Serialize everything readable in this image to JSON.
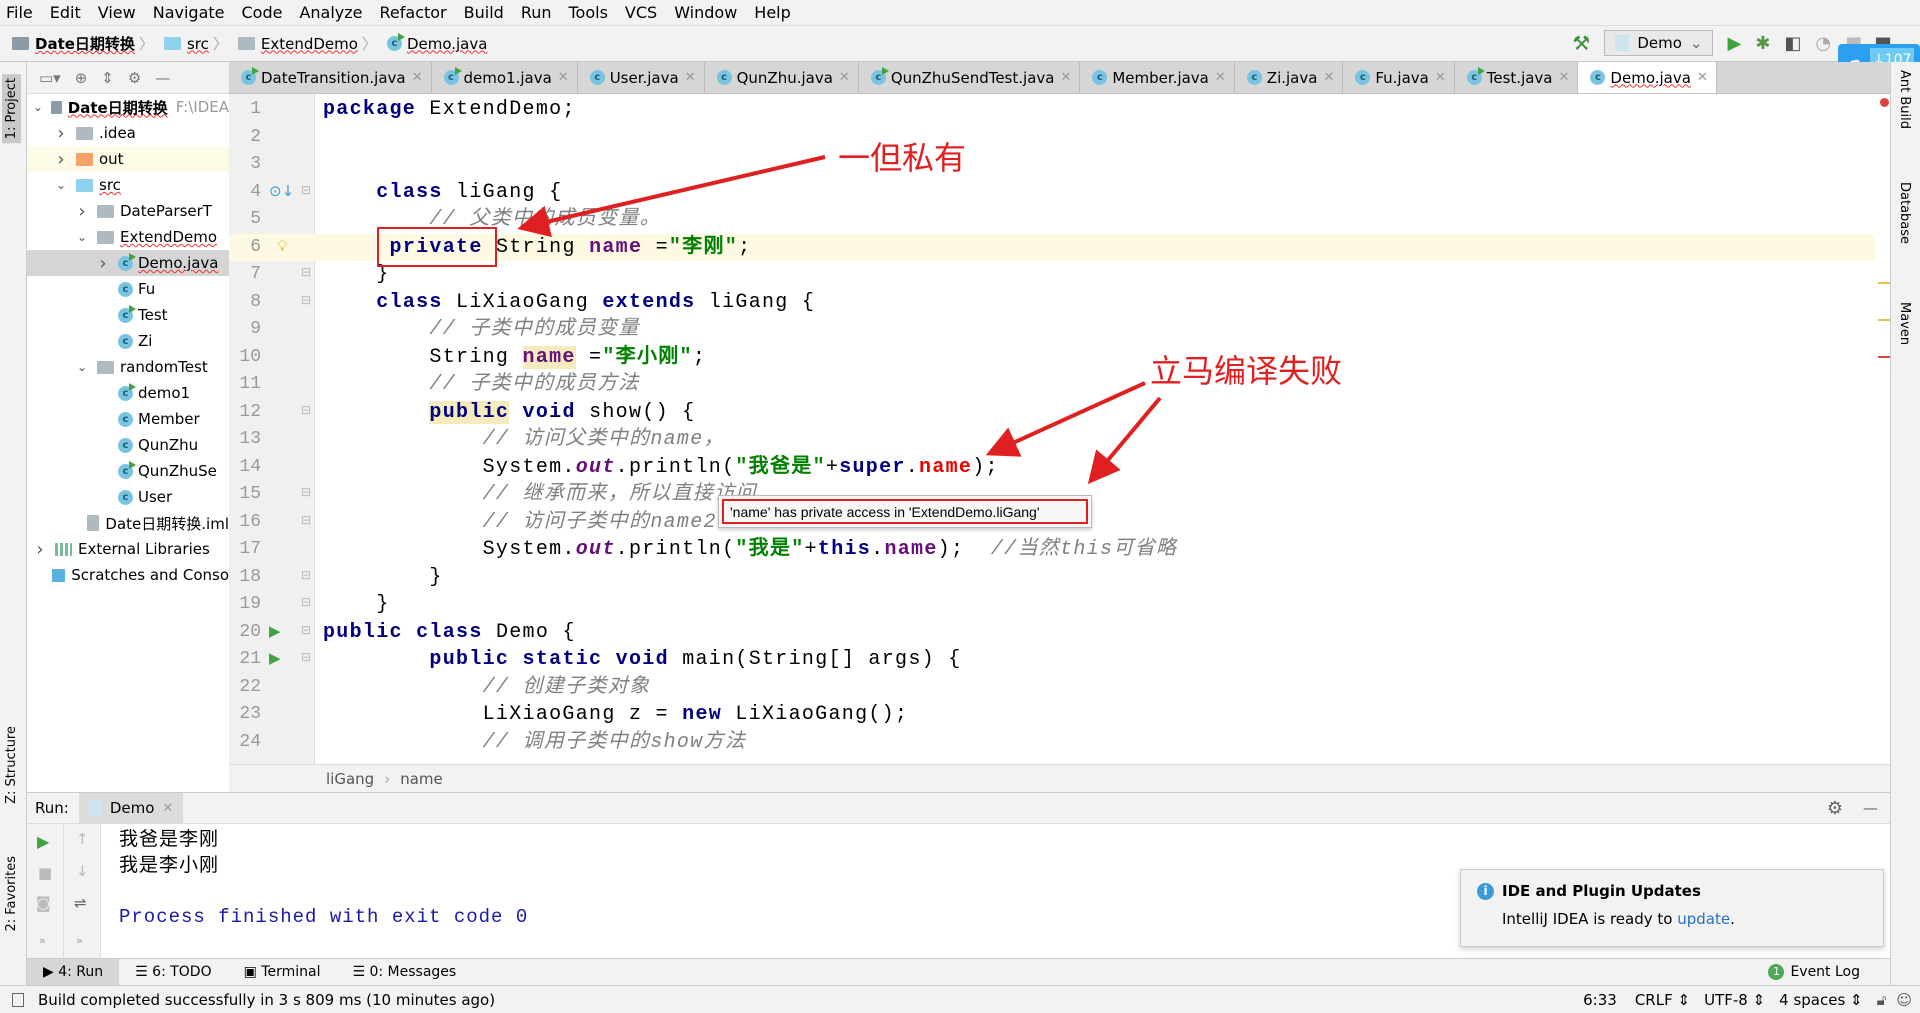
{
  "menu": [
    "File",
    "Edit",
    "View",
    "Navigate",
    "Code",
    "Analyze",
    "Refactor",
    "Build",
    "Run",
    "Tools",
    "VCS",
    "Window",
    "Help"
  ],
  "breadcrumb": [
    "Date日期转换",
    "src",
    "ExtendDemo",
    "Demo.java"
  ],
  "run_config": "Demo",
  "cloud_badge": "107",
  "left_tabs": {
    "project": "1: Project",
    "structure": "Z: Structure",
    "favorites": "2: Favorites"
  },
  "right_tabs": [
    "Ant Build",
    "Database",
    "Maven"
  ],
  "project_tree": [
    {
      "label": "Date日期转换",
      "extra": "F:\\IDEA",
      "depth": 0,
      "arrow": "v",
      "icon": "module",
      "bold": true
    },
    {
      "label": ".idea",
      "depth": 1,
      "arrow": ">",
      "icon": "folder"
    },
    {
      "label": "out",
      "depth": 1,
      "arrow": ">",
      "icon": "folder-orange",
      "hl": true
    },
    {
      "label": "src",
      "depth": 1,
      "arrow": "v",
      "icon": "folder-blue"
    },
    {
      "label": "DateParserT",
      "depth": 2,
      "arrow": ">",
      "icon": "package"
    },
    {
      "label": "ExtendDemo",
      "depth": 2,
      "arrow": "v",
      "icon": "package"
    },
    {
      "label": "Demo.java",
      "depth": 3,
      "arrow": ">",
      "icon": "class-run",
      "selected": true
    },
    {
      "label": "Fu",
      "depth": 3,
      "icon": "class"
    },
    {
      "label": "Test",
      "depth": 3,
      "icon": "class-run"
    },
    {
      "label": "Zi",
      "depth": 3,
      "icon": "class"
    },
    {
      "label": "randomTest",
      "depth": 2,
      "arrow": "v",
      "icon": "package"
    },
    {
      "label": "demo1",
      "depth": 3,
      "icon": "class-run"
    },
    {
      "label": "Member",
      "depth": 3,
      "icon": "class"
    },
    {
      "label": "QunZhu",
      "depth": 3,
      "icon": "class"
    },
    {
      "label": "QunZhuSe",
      "depth": 3,
      "icon": "class-run"
    },
    {
      "label": "User",
      "depth": 3,
      "icon": "class"
    },
    {
      "label": "Date日期转换.iml",
      "depth": 1.6,
      "icon": "file"
    },
    {
      "label": "External Libraries",
      "depth": 0,
      "arrow": ">",
      "icon": "libs"
    },
    {
      "label": "Scratches and Conso",
      "depth": 0,
      "icon": "scratch"
    }
  ],
  "tabs": [
    {
      "label": "DateTransition.java",
      "run": true
    },
    {
      "label": "demo1.java",
      "run": true
    },
    {
      "label": "User.java"
    },
    {
      "label": "QunZhu.java"
    },
    {
      "label": "QunZhuSendTest.java",
      "run": true
    },
    {
      "label": "Member.java"
    },
    {
      "label": "Zi.java"
    },
    {
      "label": "Fu.java"
    },
    {
      "label": "Test.java",
      "run": true
    },
    {
      "label": "Demo.java",
      "active": true
    }
  ],
  "code": [
    [
      [
        "package",
        "kw"
      ],
      [
        " ExtendDemo;",
        ""
      ]
    ],
    [],
    [],
    [
      [
        "    ",
        ""
      ],
      [
        "class",
        "kw"
      ],
      [
        " liGang {",
        ""
      ]
    ],
    [
      [
        "        ",
        ""
      ],
      [
        "// 父类中的成员变量。",
        "cm"
      ]
    ],
    [
      [
        "     ",
        ""
      ],
      [
        "private",
        "kw"
      ],
      [
        " String ",
        ""
      ],
      [
        "name",
        "fld"
      ],
      [
        " =",
        ""
      ],
      [
        "\"李刚\"",
        "str"
      ],
      [
        ";",
        ""
      ]
    ],
    [
      [
        "    }",
        ""
      ]
    ],
    [
      [
        "    ",
        ""
      ],
      [
        "class",
        "kw"
      ],
      [
        " LiXiaoGang ",
        ""
      ],
      [
        "extends",
        "kw"
      ],
      [
        " liGang {",
        ""
      ]
    ],
    [
      [
        "        ",
        ""
      ],
      [
        "// 子类中的成员变量",
        "cm"
      ]
    ],
    [
      [
        "        String ",
        ""
      ],
      [
        "name",
        "fld mark"
      ],
      [
        " =",
        ""
      ],
      [
        "\"李小刚\"",
        "str"
      ],
      [
        ";",
        ""
      ]
    ],
    [
      [
        "        ",
        ""
      ],
      [
        "// 子类中的成员方法",
        "cm"
      ]
    ],
    [
      [
        "        ",
        ""
      ],
      [
        "public",
        "kw mark"
      ],
      [
        " ",
        ""
      ],
      [
        "void",
        "kw"
      ],
      [
        " show() {",
        ""
      ]
    ],
    [
      [
        "            ",
        ""
      ],
      [
        "// 访问父类中的name，",
        "cm"
      ]
    ],
    [
      [
        "            System.",
        ""
      ],
      [
        "out",
        "st"
      ],
      [
        ".println(",
        ""
      ],
      [
        "\"我爸是\"",
        "str"
      ],
      [
        "+",
        ""
      ],
      [
        "super",
        "kw"
      ],
      [
        ".",
        ""
      ],
      [
        "name",
        "err"
      ],
      [
        ");",
        ""
      ]
    ],
    [
      [
        "            ",
        ""
      ],
      [
        "// 继承而来，所以直接访问",
        "cm"
      ]
    ],
    [
      [
        "            ",
        ""
      ],
      [
        "// 访问子类中的name2",
        "cm"
      ]
    ],
    [
      [
        "            System.",
        ""
      ],
      [
        "out",
        "st"
      ],
      [
        ".println(",
        ""
      ],
      [
        "\"我是\"",
        "str"
      ],
      [
        "+",
        ""
      ],
      [
        "this",
        "kw"
      ],
      [
        ".",
        ""
      ],
      [
        "name",
        "fld"
      ],
      [
        ");  ",
        ""
      ],
      [
        "//当然this可省略",
        "cm"
      ]
    ],
    [
      [
        "        }",
        ""
      ]
    ],
    [
      [
        "    }",
        ""
      ]
    ],
    [
      [
        "public",
        "kw"
      ],
      [
        " ",
        ""
      ],
      [
        "class",
        "kw"
      ],
      [
        " Demo {",
        ""
      ]
    ],
    [
      [
        "        ",
        ""
      ],
      [
        "public",
        "kw"
      ],
      [
        " ",
        ""
      ],
      [
        "static",
        "kw"
      ],
      [
        " ",
        ""
      ],
      [
        "void",
        "kw"
      ],
      [
        " main(String[] args) {",
        ""
      ]
    ],
    [
      [
        "            ",
        ""
      ],
      [
        "// 创建子类对象",
        "cm"
      ]
    ],
    [
      [
        "            LiXiaoGang z = ",
        ""
      ],
      [
        "new",
        "kw"
      ],
      [
        " LiXiaoGang();",
        ""
      ]
    ],
    [
      [
        "            ",
        ""
      ],
      [
        "// 调用子类中的show方法",
        "cm"
      ]
    ]
  ],
  "tooltip": "'name' has private access in 'ExtendDemo.liGang'",
  "annotations": {
    "private_note": "一但私有",
    "compile_note": "立马编译失败",
    "color": "#e02020"
  },
  "editor_breadcrumb": [
    "liGang",
    "name"
  ],
  "run": {
    "label": "Run:",
    "tab": "Demo",
    "output": [
      "我爸是李刚",
      "我是李小刚"
    ],
    "exit": "Process finished with exit code 0"
  },
  "bottom_tabs": [
    "4: Run",
    "6: TODO",
    "Terminal",
    "0: Messages"
  ],
  "event_log": {
    "count": "1",
    "label": "Event Log"
  },
  "notification": {
    "title": "IDE and Plugin Updates",
    "text": "IntelliJ IDEA is ready to ",
    "link": "update",
    "suffix": "."
  },
  "status": {
    "message": "Build completed successfully in 3 s 809 ms (10 minutes ago)",
    "position": "6:33",
    "line_sep": "CRLF",
    "encoding": "UTF-8",
    "indent": "4 spaces"
  }
}
